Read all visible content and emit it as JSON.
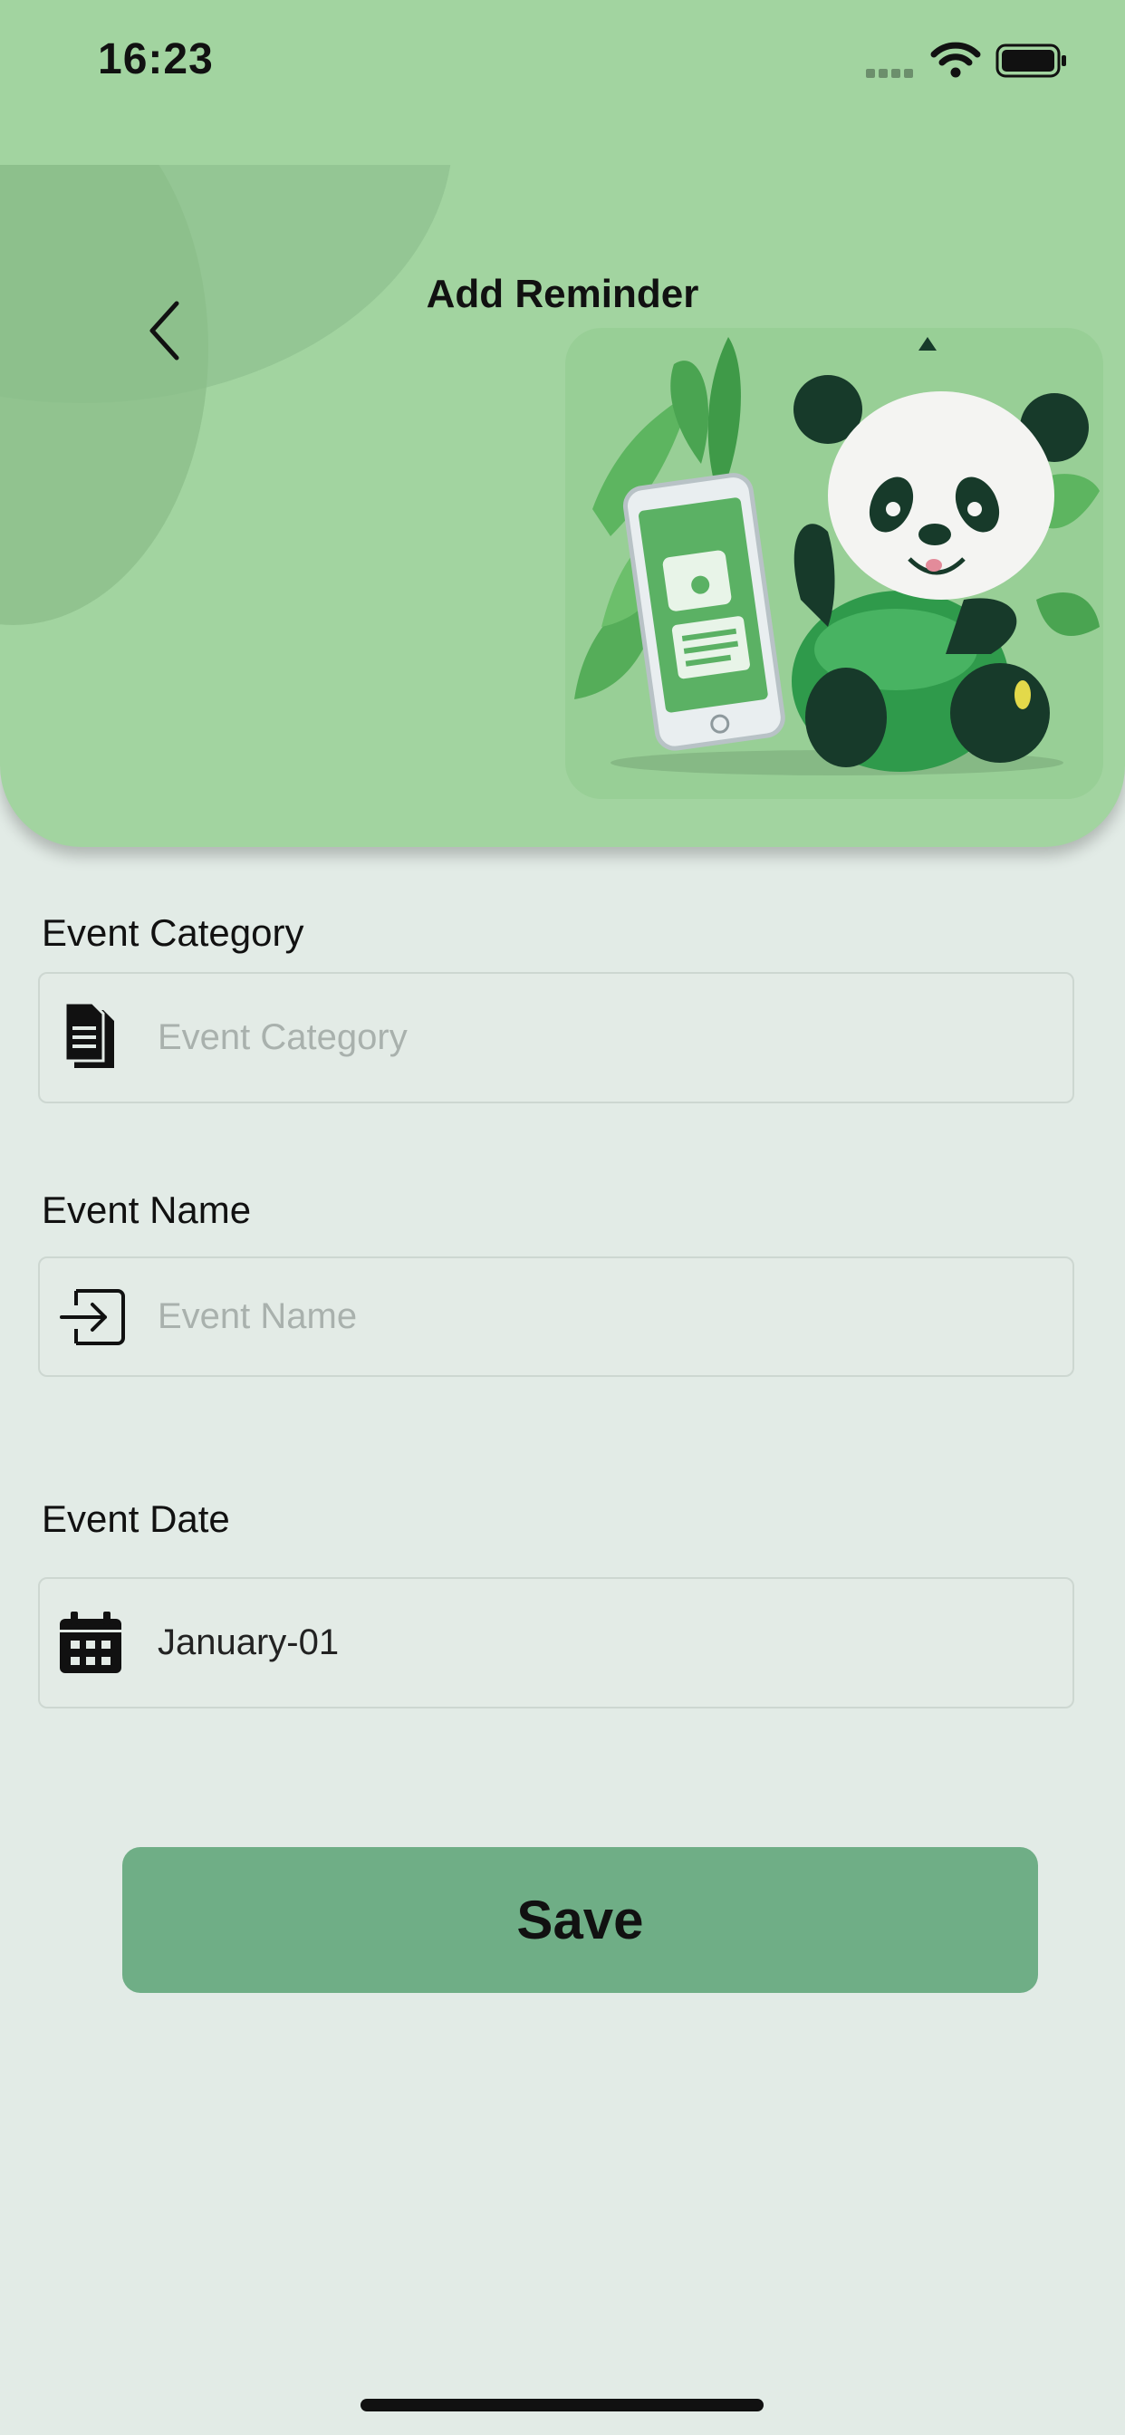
{
  "status_bar": {
    "time": "16:23"
  },
  "header": {
    "title": "Add Reminder",
    "back_icon": "chevron-left-icon"
  },
  "form": {
    "category": {
      "label": "Event Category",
      "placeholder": "Event Category",
      "icon": "document-icon"
    },
    "name": {
      "label": "Event Name",
      "placeholder": "Event Name",
      "icon": "login-icon"
    },
    "date": {
      "label": "Event Date",
      "value": "January-01",
      "icon": "calendar-icon"
    }
  },
  "actions": {
    "save_label": "Save"
  },
  "colors": {
    "header_bg": "#a2d4a0",
    "page_bg": "#e2ebe6",
    "save_bg": "#6fae86"
  }
}
